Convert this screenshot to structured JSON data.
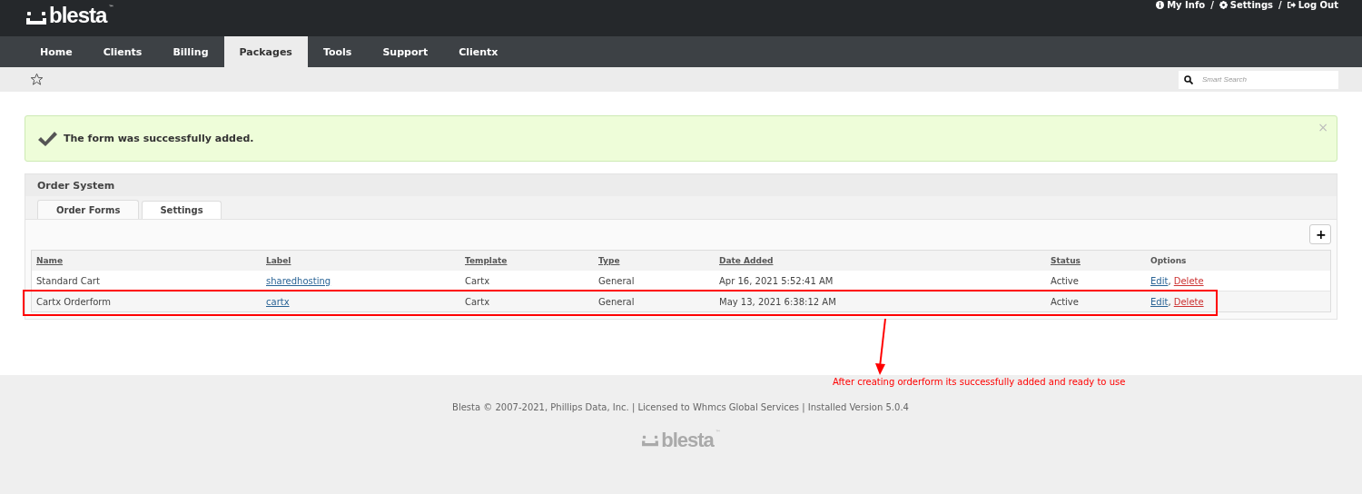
{
  "logo": {
    "text": "blesta",
    "mark": "™"
  },
  "user_links": [
    "My Info",
    "Settings",
    "Log Out"
  ],
  "user_link_separator": "/",
  "nav": [
    {
      "label": "Home",
      "selected": false
    },
    {
      "label": "Clients",
      "selected": false
    },
    {
      "label": "Billing",
      "selected": false
    },
    {
      "label": "Packages",
      "selected": true
    },
    {
      "label": "Tools",
      "selected": false
    },
    {
      "label": "Support",
      "selected": false
    },
    {
      "label": "Clientx",
      "selected": false
    }
  ],
  "search": {
    "placeholder": "Smart Search"
  },
  "alert": {
    "message": "The form was successfully added.",
    "close": "×"
  },
  "panel": {
    "title": "Order System",
    "tabs": [
      {
        "label": "Order Forms",
        "selected": true
      },
      {
        "label": "Settings",
        "selected": false
      }
    ],
    "add_button": "+",
    "option_separator": ",",
    "table": {
      "columns": [
        "Name",
        "Label",
        "Template",
        "Type",
        "Date Added",
        "Status",
        "Options"
      ],
      "rows": [
        {
          "name": "Standard Cart",
          "label": "sharedhosting",
          "template": "Cartx",
          "type": "General",
          "date_added": "Apr 16, 2021 5:52:41 AM",
          "status": "Active",
          "options": [
            "Edit",
            "Delete"
          ]
        },
        {
          "name": "Cartx Orderform",
          "label": "cartx",
          "template": "Cartx",
          "type": "General",
          "date_added": "May 13, 2021 6:38:12 AM",
          "status": "Active",
          "options": [
            "Edit",
            "Delete"
          ]
        }
      ]
    }
  },
  "annotation": {
    "text": "After creating orderform its successfully added and ready to use"
  },
  "footer": {
    "text": "Blesta © 2007-2021, Phillips Data, Inc. | Licensed to Whmcs Global Services | Installed Version 5.0.4",
    "logo": {
      "text": "blesta",
      "mark": "™"
    }
  }
}
